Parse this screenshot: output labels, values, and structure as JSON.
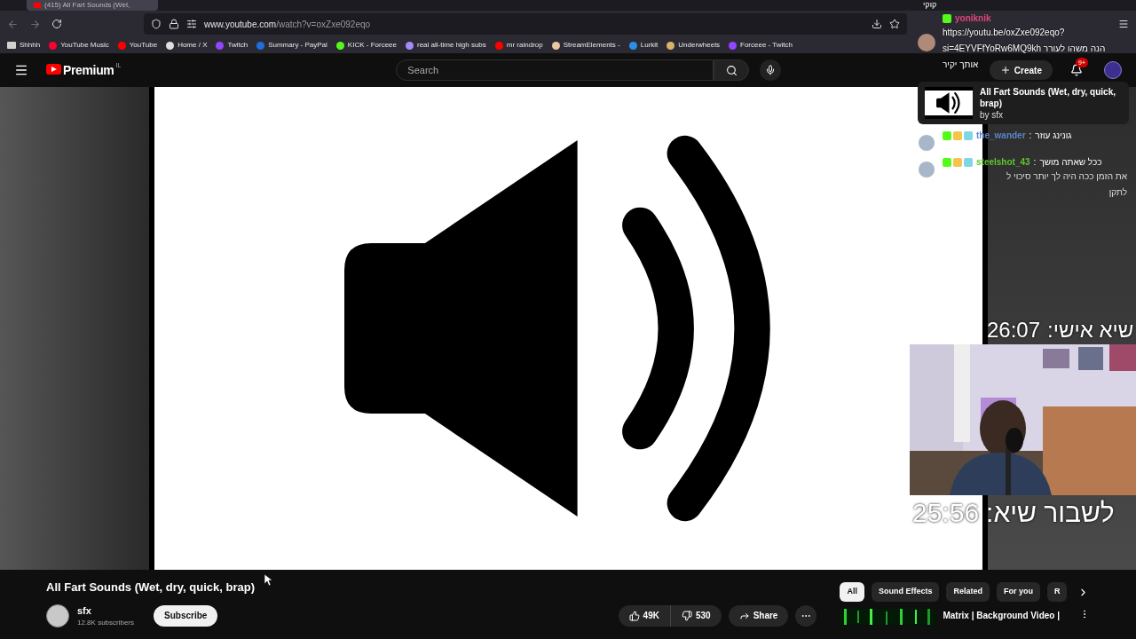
{
  "browser": {
    "tab_title": "(415) All Fart Sounds (Wet,",
    "url_host": "www.youtube.com",
    "url_path": "/watch?v=oxZxe092eqo",
    "bookmarks": [
      {
        "label": "Shhhh",
        "kind": "folder",
        "color": "#d0d0d0"
      },
      {
        "label": "YouTube Music",
        "kind": "site",
        "color": "#ff0033"
      },
      {
        "label": "YouTube",
        "kind": "site",
        "color": "#ff0000"
      },
      {
        "label": "Home / X",
        "kind": "site",
        "color": "#e0e0e0"
      },
      {
        "label": "Twitch",
        "kind": "site",
        "color": "#9146ff"
      },
      {
        "label": "Summary - PayPal",
        "kind": "site",
        "color": "#1d6fe0"
      },
      {
        "label": "KICK - Forceee",
        "kind": "site",
        "color": "#53fc18"
      },
      {
        "label": "real all-time high subs",
        "kind": "site",
        "color": "#a78bfa"
      },
      {
        "label": "mr raindrop",
        "kind": "site",
        "color": "#ff0000"
      },
      {
        "label": "StreamElements -",
        "kind": "site",
        "color": "#e8c9a0"
      },
      {
        "label": "Lurkit",
        "kind": "site",
        "color": "#2b8fe6"
      },
      {
        "label": "Underwheels",
        "kind": "site",
        "color": "#d9b26a"
      },
      {
        "label": "Forceee - Twitch",
        "kind": "site",
        "color": "#9146ff"
      }
    ]
  },
  "youtube": {
    "logo_label": "Premium",
    "region": "IL",
    "search_placeholder": "Search",
    "create_label": "Create",
    "notification_count": "9+"
  },
  "video": {
    "title": "All Fart Sounds (Wet, dry, quick, brap)",
    "channel": "sfx",
    "subscribers": "12.8K subscribers",
    "subscribe_label": "Subscribe",
    "likes": "49K",
    "dislikes": "530",
    "share_label": "Share"
  },
  "chips": [
    {
      "label": "All",
      "selected": true
    },
    {
      "label": "Sound Effects",
      "selected": false
    },
    {
      "label": "Related",
      "selected": false
    },
    {
      "label": "For you",
      "selected": false
    },
    {
      "label": "R",
      "selected": false
    }
  ],
  "recommendation": {
    "title": "Matrix | Background Video |"
  },
  "overlay": {
    "top_text": "קוקי",
    "pinned_chat": {
      "user": "yoniknik",
      "color": "#e0457b",
      "lines": [
        "https://youtu.be/oxZxe092eqo?",
        "si=4EYVFfYoRw6MQ9kh הנה משהו לעורר",
        "אותך יקיר"
      ]
    },
    "now_playing": {
      "title": "All Fart Sounds (Wet, dry, quick, brap)",
      "artist": "by sfx"
    },
    "chat": [
      {
        "user": "the_wander",
        "color": "#5a86c8",
        "separator": ":",
        "lines": [
          "גונינג עוזר"
        ]
      },
      {
        "user": "steelshot_43",
        "color": "#5ec52b",
        "separator": ":",
        "lines": [
          "ככל שאתה מושך",
          "את הזמן ככה היה לך יותר סיכוי ל",
          "לתקן"
        ]
      }
    ],
    "timers": [
      {
        "label": "שיא אישי:",
        "time": "26:07"
      },
      {
        "label": "לשבור שיא:",
        "time": "25:56"
      }
    ]
  }
}
